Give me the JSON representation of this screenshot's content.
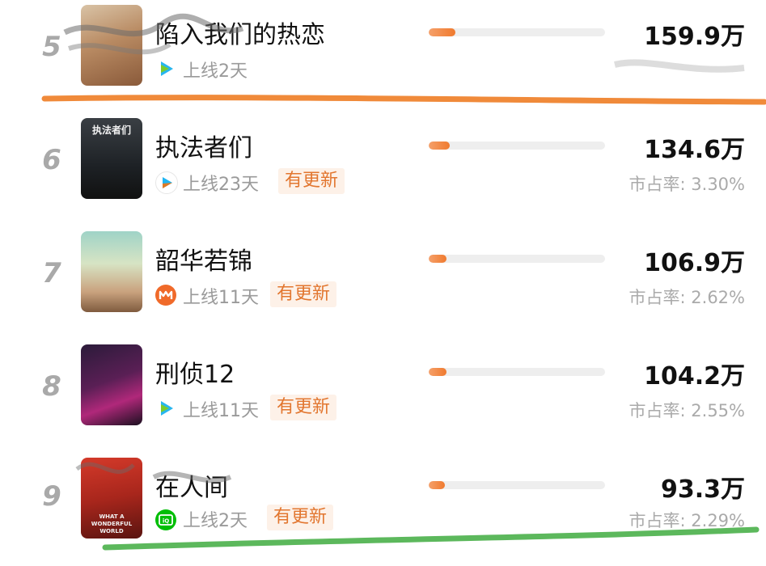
{
  "colors": {
    "accent_orange": "#f07a2e",
    "badge_bg": "#fdf1e8",
    "rank_gray": "#a9a9a9",
    "underline_orange": "#f08a3a",
    "underline_green": "#5cb85c"
  },
  "list": [
    {
      "rank": "5",
      "title": "陷入我们的热恋",
      "platform_icon": "tencent-video-icon",
      "online": "上线2天",
      "badge": "",
      "heat": "159.9万",
      "share": "",
      "bar_fraction": 0.15
    },
    {
      "rank": "6",
      "title": "执法者们",
      "poster_text": "执法者们",
      "platform_icon": "youku-icon",
      "online": "上线23天",
      "badge": "有更新",
      "heat": "134.6万",
      "share": "市占率: 3.30%",
      "bar_fraction": 0.12
    },
    {
      "rank": "7",
      "title": "韶华若锦",
      "platform_icon": "mango-tv-icon",
      "online": "上线11天",
      "badge": "有更新",
      "heat": "106.9万",
      "share": "市占率: 2.62%",
      "bar_fraction": 0.1
    },
    {
      "rank": "8",
      "title": "刑侦12",
      "platform_icon": "tencent-video-icon",
      "online": "上线11天",
      "badge": "有更新",
      "heat": "104.2万",
      "share": "市占率: 2.55%",
      "bar_fraction": 0.1
    },
    {
      "rank": "9",
      "title": "在人间",
      "poster_text": "WHAT A WONDERFUL WORLD",
      "platform_icon": "iqiyi-icon",
      "online": "上线2天",
      "badge": "有更新",
      "heat": "93.3万",
      "share": "市占率: 2.29%",
      "bar_fraction": 0.09
    }
  ]
}
